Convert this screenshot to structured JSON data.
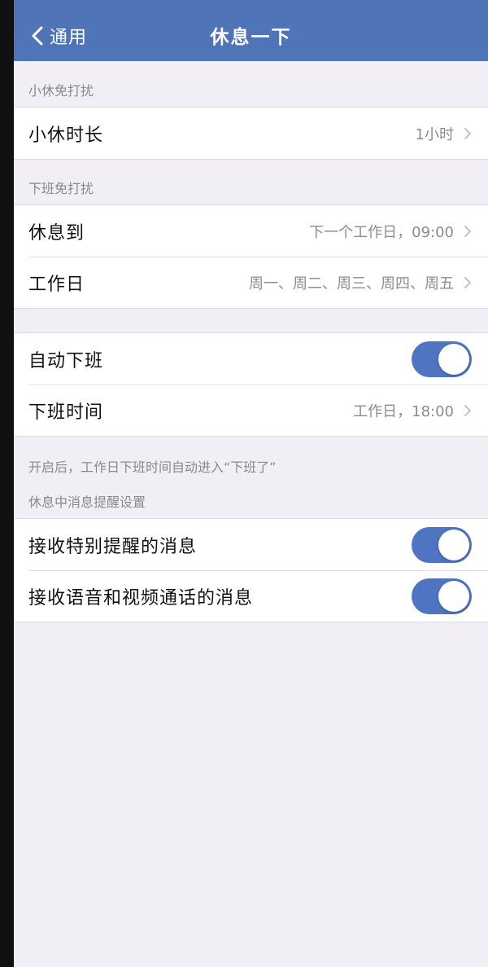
{
  "nav": {
    "back_label": "通用",
    "title": "休息一下"
  },
  "sections": {
    "short_break_header": "小休免打扰",
    "off_work_header": "下班免打扰",
    "message_header": "休息中消息提醒设置"
  },
  "short_break": {
    "duration_label": "小休时长",
    "duration_value": "1小时"
  },
  "off_work": {
    "rest_until_label": "休息到",
    "rest_until_value": "下一个工作日，09:00",
    "workdays_label": "工作日",
    "workdays_value": "周一、周二、周三、周四、周五"
  },
  "auto_off": {
    "auto_label": "自动下班",
    "auto_on": true,
    "time_label": "下班时间",
    "time_value": "工作日，18:00",
    "footnote": "开启后，工作日下班时间自动进入“下班了”"
  },
  "messages": {
    "special_label": "接收特别提醒的消息",
    "special_on": true,
    "calls_label": "接收语音和视频通话的消息",
    "calls_on": true
  },
  "colors": {
    "nav_bar": "#4f74b8",
    "toggle_on": "#4f74c2",
    "background": "#f1eff5"
  }
}
